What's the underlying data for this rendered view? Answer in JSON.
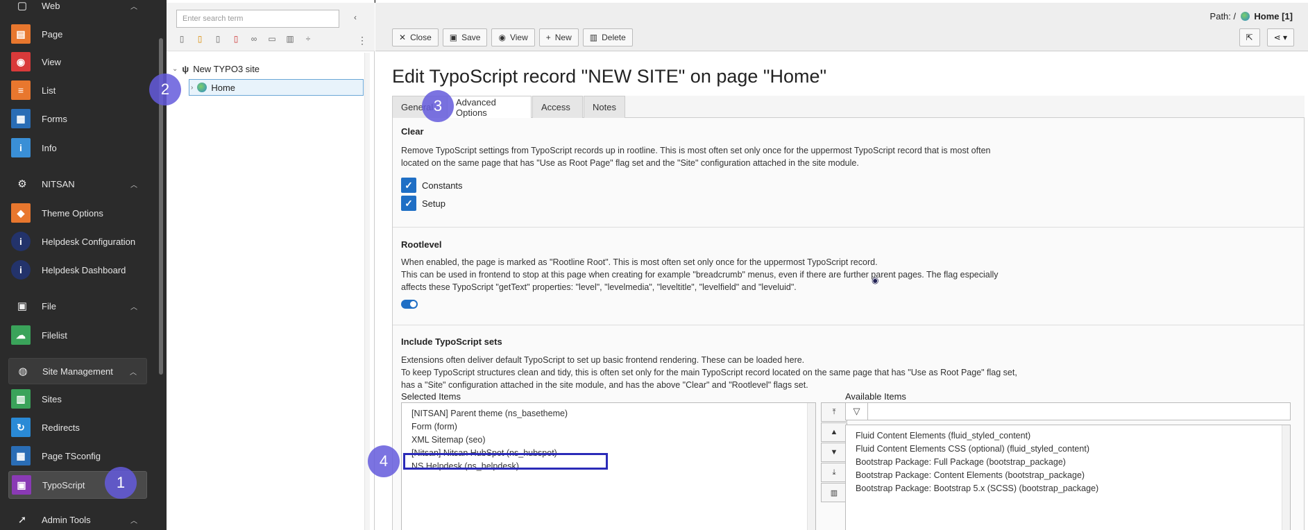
{
  "module_menu": {
    "groups": [
      {
        "label": "Web",
        "icon": "web-icon"
      },
      {
        "label": "NITSAN",
        "icon": "gear-icon"
      },
      {
        "label": "File",
        "icon": "image-icon"
      },
      {
        "label": "Site Management",
        "icon": "globe-icon"
      },
      {
        "label": "Admin Tools",
        "icon": "rocket-icon"
      }
    ],
    "items": [
      {
        "label": "Page",
        "color": "#e8772e",
        "glyph": "▤"
      },
      {
        "label": "View",
        "color": "#d93a3a",
        "glyph": "◉"
      },
      {
        "label": "List",
        "color": "#e8772e",
        "glyph": "≡"
      },
      {
        "label": "Forms",
        "color": "#2a6db5",
        "glyph": "▦"
      },
      {
        "label": "Info",
        "color": "#3a8fd6",
        "glyph": "i"
      },
      {
        "label": "Theme Options",
        "color": "#e8772e",
        "glyph": "◆"
      },
      {
        "label": "Helpdesk Configuration",
        "color": "#23336b",
        "glyph": "i"
      },
      {
        "label": "Helpdesk Dashboard",
        "color": "#23336b",
        "glyph": "i"
      },
      {
        "label": "Filelist",
        "color": "#3aa35a",
        "glyph": "☁"
      },
      {
        "label": "Sites",
        "color": "#3aa35a",
        "glyph": "▥"
      },
      {
        "label": "Redirects",
        "color": "#2a8ad6",
        "glyph": "↻"
      },
      {
        "label": "Page TSconfig",
        "color": "#2a6db5",
        "glyph": "▦"
      },
      {
        "label": "TypoScript",
        "color": "#8a3ab5",
        "glyph": "▣"
      }
    ]
  },
  "tree": {
    "search_placeholder": "Enter search term",
    "root_label": "New TYPO3 site",
    "home_label": "Home"
  },
  "header": {
    "path_prefix": "Path: /",
    "path_current": "Home [1]",
    "buttons": {
      "close": "Close",
      "save": "Save",
      "view": "View",
      "new": "New",
      "delete": "Delete"
    }
  },
  "title": "Edit TypoScript record \"NEW SITE\" on page \"Home\"",
  "tabs": [
    "General",
    "Advanced Options",
    "Access",
    "Notes"
  ],
  "clear": {
    "title": "Clear",
    "desc1": "Remove TypoScript settings from TypoScript records up in rootline. This is most often set only once for the uppermost TypoScript record that is most often",
    "desc2": "located on the same page that has \"Use as Root Page\" flag set and the \"Site\" configuration attached in the site module.",
    "constants": "Constants",
    "setup": "Setup"
  },
  "rootlevel": {
    "title": "Rootlevel",
    "desc1": "When enabled, the page is marked as \"Rootline Root\". This is most often set only once for the uppermost TypoScript record.",
    "desc2": "This can be used in frontend to stop at this page when creating for example \"breadcrumb\" menus, even if there are further parent pages. The flag especially",
    "desc3": "affects these TypoScript \"getText\" properties: \"level\", \"levelmedia\", \"leveltitle\", \"levelfield\" and \"leveluid\"."
  },
  "include": {
    "title": "Include TypoScript sets",
    "desc1": "Extensions often deliver default TypoScript to set up basic frontend rendering. These can be loaded here.",
    "desc2": "To keep TypoScript structures clean and tidy, this is often set only for the main TypoScript record located on the same page that has \"Use as Root Page\" flag set,",
    "desc3": "has a \"Site\" configuration attached in the site module, and has the above \"Clear\" and \"Rootlevel\" flags set.",
    "selected_label": "Selected Items",
    "available_label": "Available Items",
    "selected": [
      "[NITSAN] Parent theme (ns_basetheme)",
      "Form (form)",
      "XML Sitemap (seo)",
      "[Nitsan] Nitsan HubSpot (ns_hubspot)",
      "NS Helpdesk (ns_helpdesk)"
    ],
    "available": [
      "Fluid Content Elements (fluid_styled_content)",
      "Fluid Content Elements CSS (optional) (fluid_styled_content)",
      "Bootstrap Package: Full Package (bootstrap_package)",
      "Bootstrap Package: Content Elements (bootstrap_package)",
      "Bootstrap Package: Bootstrap 5.x (SCSS) (bootstrap_package)"
    ]
  },
  "steps": [
    "1",
    "2",
    "3",
    "4"
  ]
}
